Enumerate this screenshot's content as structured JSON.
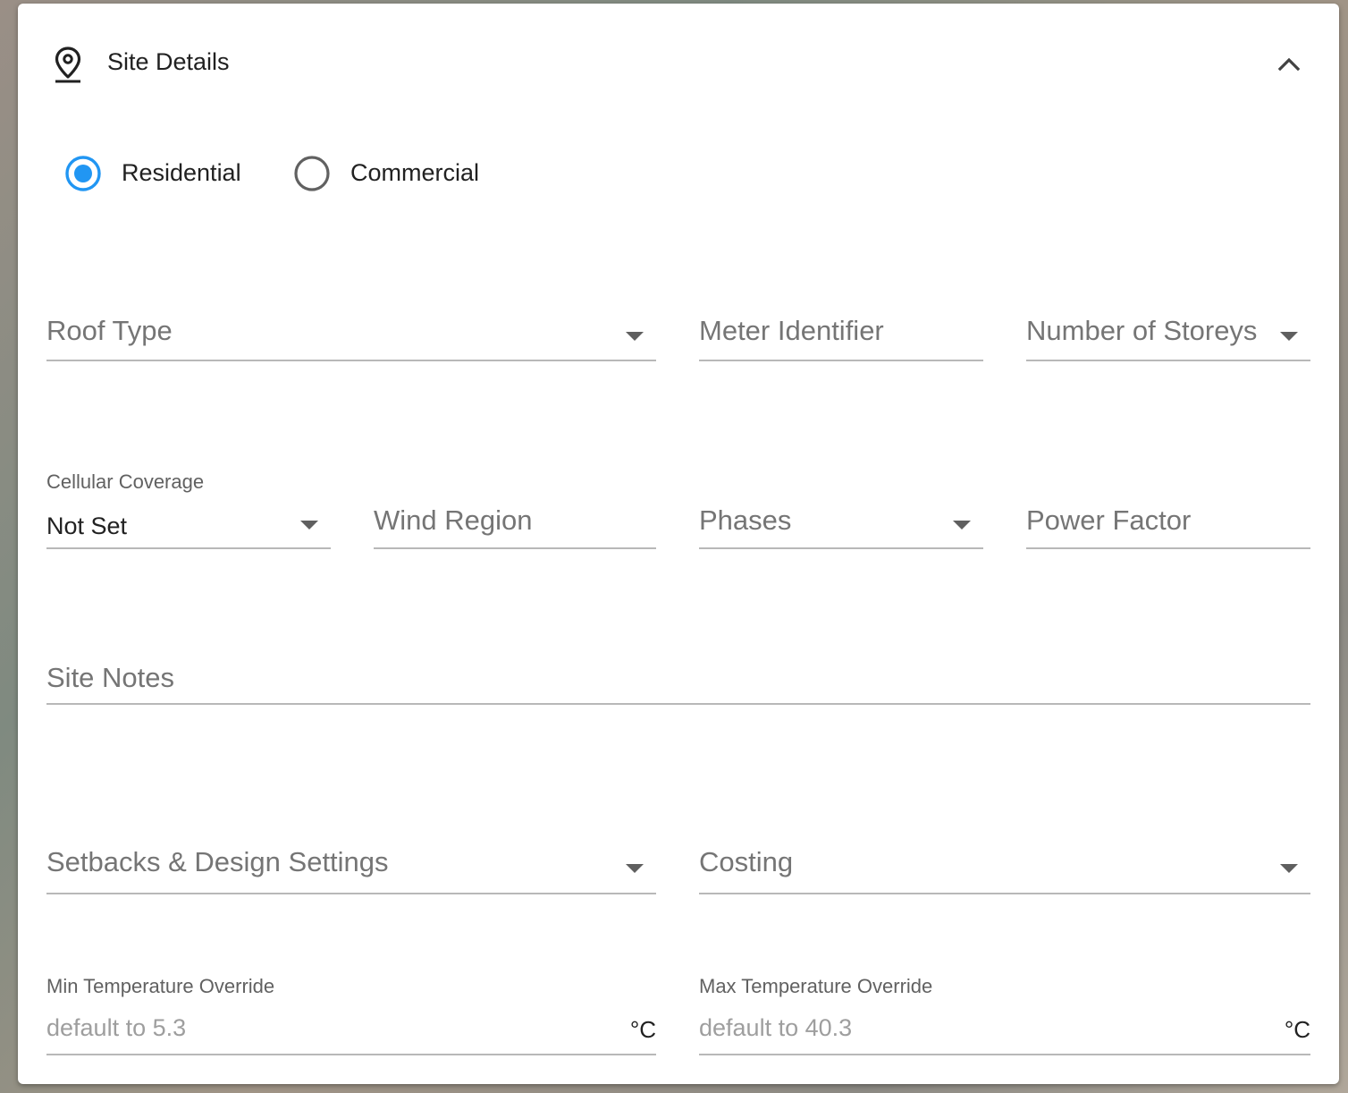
{
  "header": {
    "title": "Site Details"
  },
  "site_type": {
    "options": [
      {
        "label": "Residential",
        "selected": true
      },
      {
        "label": "Commercial",
        "selected": false
      }
    ]
  },
  "fields": {
    "roof_type": {
      "placeholder": "Roof Type"
    },
    "meter_identifier": {
      "placeholder": "Meter Identifier"
    },
    "number_of_storeys": {
      "placeholder": "Number of Storeys"
    },
    "cellular_coverage": {
      "label": "Cellular Coverage",
      "value": "Not Set"
    },
    "wind_region": {
      "placeholder": "Wind Region"
    },
    "phases": {
      "placeholder": "Phases"
    },
    "power_factor": {
      "placeholder": "Power Factor"
    },
    "site_notes": {
      "placeholder": "Site Notes"
    },
    "setbacks": {
      "placeholder": "Setbacks & Design Settings"
    },
    "costing": {
      "placeholder": "Costing"
    },
    "min_temp": {
      "label": "Min Temperature Override",
      "placeholder": "default to 5.3",
      "unit": "°C"
    },
    "max_temp": {
      "label": "Max Temperature Override",
      "placeholder": "default to 40.3",
      "unit": "°C"
    }
  },
  "colors": {
    "accent": "#2196f3",
    "text": "#212121",
    "placeholder": "#757575",
    "underline": "#b8b8b8"
  }
}
